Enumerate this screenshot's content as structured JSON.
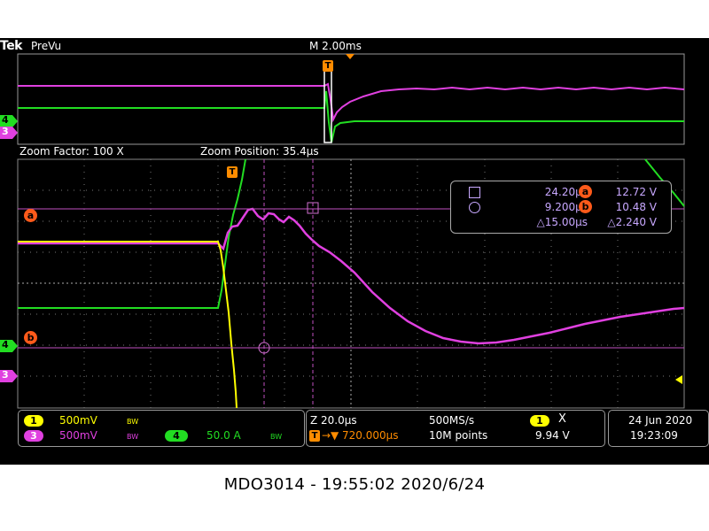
{
  "header": {
    "brand": "Tek",
    "preview_mode": "PreVu",
    "main_timebase": "M 2.00ms"
  },
  "zoom": {
    "factor": "Zoom Factor: 100 X",
    "position": "Zoom Position: 35.4µs"
  },
  "markers": {
    "trigger": "T",
    "cursor_a": "a",
    "cursor_b": "b",
    "ch1": "1",
    "ch3": "3",
    "ch4": "4"
  },
  "measurements": {
    "cursor1_time": "24.20µs",
    "cursor_a_value": "12.72 V",
    "cursor2_time": "9.200µs",
    "cursor_b_value": "10.48 V",
    "delta_time": "△15.00µs",
    "delta_value": "△2.240 V"
  },
  "channels": {
    "ch1": {
      "label": "1",
      "scale": "500mV",
      "bw": "BW"
    },
    "ch3": {
      "label": "3",
      "scale": "500mV",
      "bw": "BW"
    },
    "ch4": {
      "label": "4",
      "scale": "50.0 A",
      "bw": "BW"
    }
  },
  "timebase": {
    "zoom_scale": "Z 20.0µs",
    "sample_rate": "500MS/s",
    "trigger_position": "720.000µs",
    "record_length": "10M points"
  },
  "trigger": {
    "source": "1",
    "slope": "Ⅹ",
    "level": "9.94 V"
  },
  "datetime": {
    "date": "24 Jun  2020",
    "time": "19:23:09"
  },
  "caption": "MDO3014 - 19:55:02   2020/6/24",
  "colors": {
    "ch1": "#ffff00",
    "ch3": "#e040e0",
    "ch4": "#22dd22",
    "cursor": "#ff5a1a",
    "grid": "#888888"
  }
}
